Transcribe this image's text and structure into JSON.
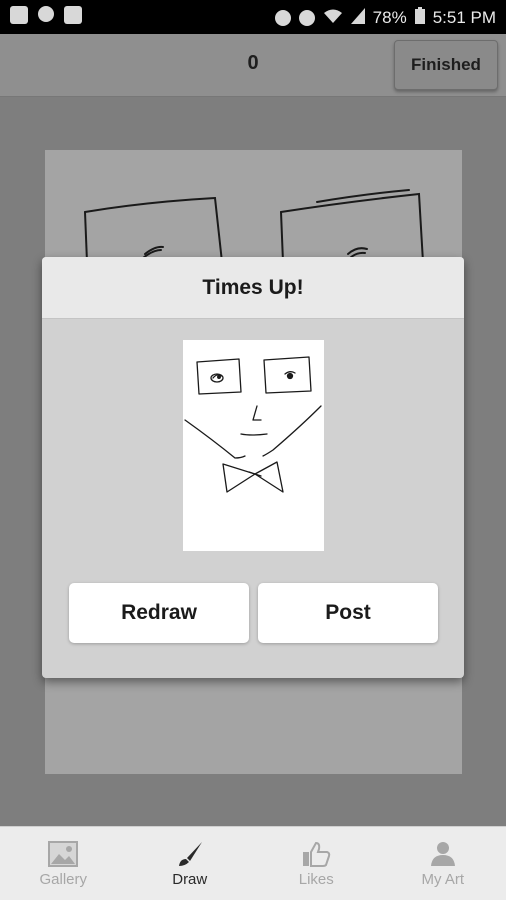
{
  "status_bar": {
    "battery": "78%",
    "time": "5:51 PM",
    "icons": [
      "message-icon",
      "reddit-icon",
      "image-icon",
      "mute-icon",
      "alarm-icon",
      "wifi-icon",
      "signal-icon",
      "battery-icon"
    ]
  },
  "top_bar": {
    "score": "0",
    "finished_label": "Finished"
  },
  "dialog": {
    "title": "Times Up!",
    "redraw_label": "Redraw",
    "post_label": "Post"
  },
  "nav": {
    "items": [
      {
        "label": "Gallery",
        "icon": "gallery-icon",
        "active": false
      },
      {
        "label": "Draw",
        "icon": "brush-icon",
        "active": true
      },
      {
        "label": "Likes",
        "icon": "thumbs-up-icon",
        "active": false
      },
      {
        "label": "My Art",
        "icon": "person-icon",
        "active": false
      }
    ]
  },
  "colors": {
    "overlay": "#7e7e7e",
    "dialog_bg": "#d1d1d1",
    "dialog_header": "#e9e9e9",
    "nav_active": "#2a2a2a",
    "nav_inactive": "#a7a7a7"
  }
}
